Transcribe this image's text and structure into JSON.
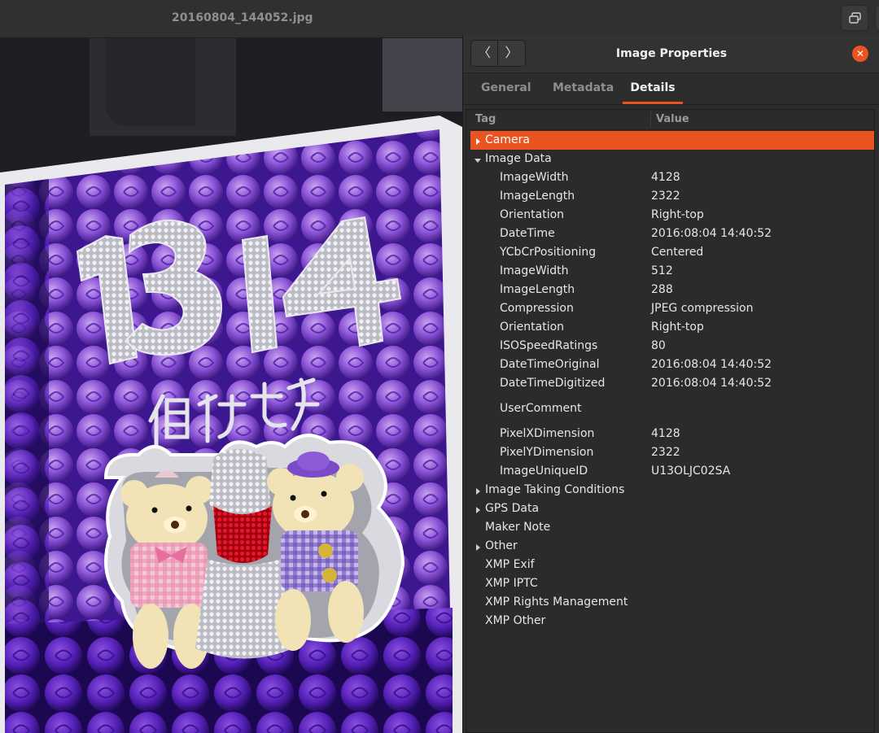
{
  "window": {
    "title": "20160804_144052.jpg",
    "restore_icon": "restore-window-icon"
  },
  "dialog": {
    "title": "Image Properties",
    "back_label": "〈",
    "forward_label": "〉",
    "close_label": "✕",
    "tabs": [
      {
        "label": "General",
        "active": false
      },
      {
        "label": "Metadata",
        "active": false
      },
      {
        "label": "Details",
        "active": true
      }
    ],
    "columns": {
      "tag": "Tag",
      "value": "Value"
    },
    "accent": "#e95420",
    "rows": [
      {
        "tag": "Camera",
        "value": "",
        "level": 0,
        "expander": "collapsed",
        "selected": true
      },
      {
        "tag": "Image Data",
        "value": "",
        "level": 0,
        "expander": "expanded",
        "selected": false
      },
      {
        "tag": "ImageWidth",
        "value": "4128",
        "level": 1
      },
      {
        "tag": "ImageLength",
        "value": "2322",
        "level": 1
      },
      {
        "tag": "Orientation",
        "value": "Right-top",
        "level": 1
      },
      {
        "tag": "DateTime",
        "value": "2016:08:04 14:40:52",
        "level": 1
      },
      {
        "tag": "YCbCrPositioning",
        "value": "Centered",
        "level": 1
      },
      {
        "tag": "ImageWidth",
        "value": "512",
        "level": 1
      },
      {
        "tag": "ImageLength",
        "value": "288",
        "level": 1
      },
      {
        "tag": "Compression",
        "value": "JPEG compression",
        "level": 1
      },
      {
        "tag": "Orientation",
        "value": "Right-top",
        "level": 1
      },
      {
        "tag": "ISOSpeedRatings",
        "value": "80",
        "level": 1
      },
      {
        "tag": "DateTimeOriginal",
        "value": "2016:08:04 14:40:52",
        "level": 1
      },
      {
        "tag": "DateTimeDigitized",
        "value": "2016:08:04 14:40:52",
        "level": 1
      },
      {
        "tag": "UserComment",
        "value": "",
        "level": 1,
        "tall": true
      },
      {
        "tag": "PixelXDimension",
        "value": "4128",
        "level": 1
      },
      {
        "tag": "PixelYDimension",
        "value": "2322",
        "level": 1
      },
      {
        "tag": "ImageUniqueID",
        "value": "U13OLJC02SA",
        "level": 1
      },
      {
        "tag": "Image Taking Conditions",
        "value": "",
        "level": 0,
        "expander": "collapsed"
      },
      {
        "tag": "GPS Data",
        "value": "",
        "level": 0,
        "expander": "collapsed"
      },
      {
        "tag": "Maker Note",
        "value": "",
        "level": 0,
        "expander": "none"
      },
      {
        "tag": "Other",
        "value": "",
        "level": 0,
        "expander": "collapsed"
      },
      {
        "tag": "XMP Exif",
        "value": "",
        "level": 0,
        "expander": "none"
      },
      {
        "tag": "XMP IPTC",
        "value": "",
        "level": 0,
        "expander": "none"
      },
      {
        "tag": "XMP Rights Management",
        "value": "",
        "level": 0,
        "expander": "none"
      },
      {
        "tag": "XMP Other",
        "value": "",
        "level": 0,
        "expander": "none"
      }
    ]
  }
}
